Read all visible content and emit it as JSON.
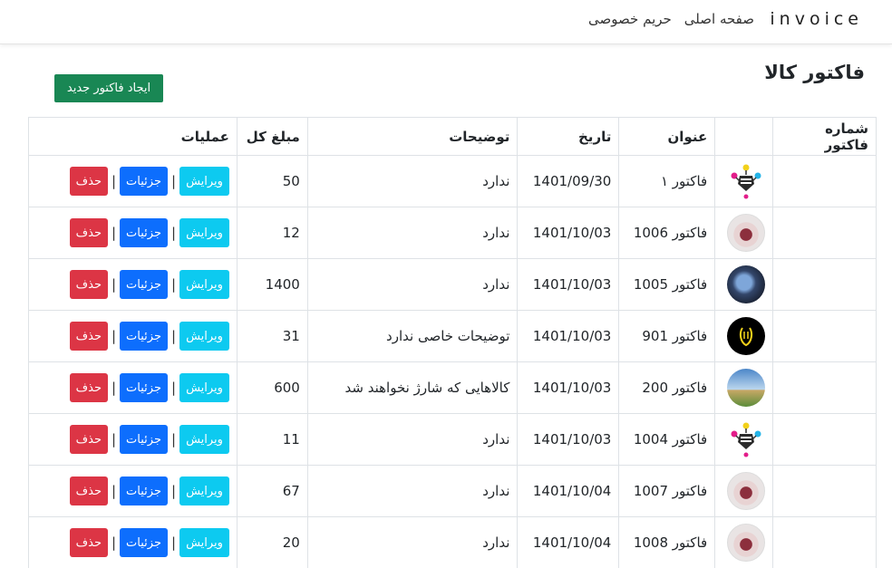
{
  "navbar": {
    "brand": "invoice",
    "links": [
      "صفحه اصلی",
      "حریم خصوصی"
    ]
  },
  "page": {
    "title": "فاکتور کالا",
    "create_button": "ایجاد فاکتور جدید"
  },
  "table": {
    "headers": {
      "number": "شماره فاکتور",
      "image": "",
      "title": "عنوان",
      "date": "تاریخ",
      "description": "توضیحات",
      "total": "مبلغ کل",
      "operations": "عملیات"
    },
    "actions": {
      "edit": "ویرایش",
      "details": "جزئیات",
      "delete": "حذف",
      "separator": "|"
    },
    "rows": [
      {
        "number": "",
        "image": "ink-icon",
        "title": "فاکتور ۱",
        "date": "1401/09/30",
        "description": "ندارد",
        "total": "50"
      },
      {
        "number": "",
        "image": "floral-icon",
        "title": "فاکتور 1006",
        "date": "1401/10/03",
        "description": "ندارد",
        "total": "12"
      },
      {
        "number": "",
        "image": "blue-flower-icon",
        "title": "فاکتور 1005",
        "date": "1401/10/03",
        "description": "ندارد",
        "total": "1400"
      },
      {
        "number": "",
        "image": "black-logo-icon",
        "title": "فاکتور 901",
        "date": "1401/10/03",
        "description": "توضیحات خاصی ندارد",
        "total": "31"
      },
      {
        "number": "",
        "image": "landscape-icon",
        "title": "فاکتور 200",
        "date": "1401/10/03",
        "description": "کالاهایی که شارژ نخواهند شد",
        "total": "600"
      },
      {
        "number": "",
        "image": "ink-icon",
        "title": "فاکتور 1004",
        "date": "1401/10/03",
        "description": "ندارد",
        "total": "11"
      },
      {
        "number": "",
        "image": "floral-icon",
        "title": "فاکتور 1007",
        "date": "1401/10/04",
        "description": "ندارد",
        "total": "67"
      },
      {
        "number": "",
        "image": "floral-icon",
        "title": "فاکتور 1008",
        "date": "1401/10/04",
        "description": "ندارد",
        "total": "20"
      }
    ]
  },
  "colors": {
    "success": "#198754",
    "info": "#0dcaf0",
    "primary": "#0d6efd",
    "danger": "#dc3545"
  }
}
